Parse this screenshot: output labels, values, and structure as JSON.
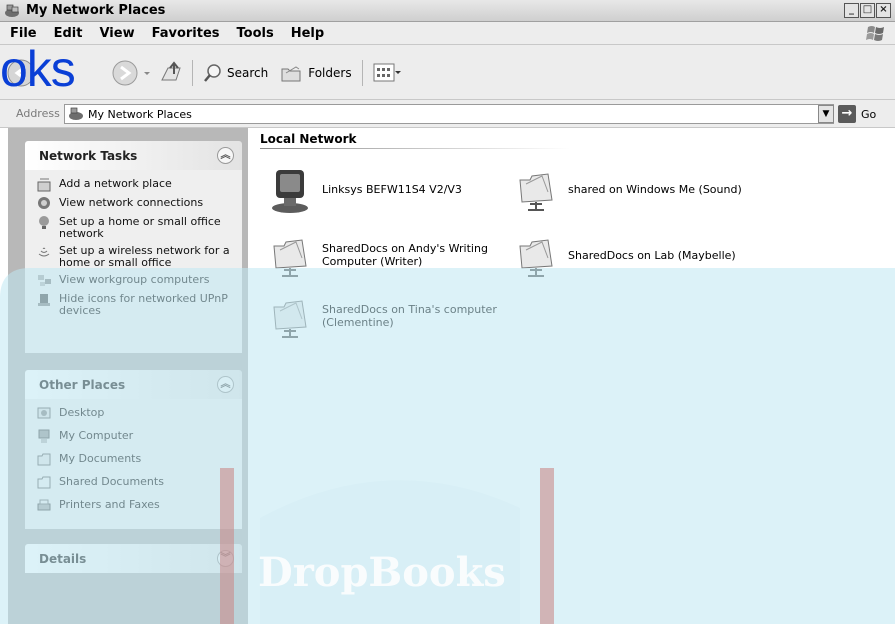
{
  "window": {
    "title": "My Network Places",
    "controls": [
      "minimize",
      "maximize",
      "close"
    ]
  },
  "menu": {
    "items": [
      {
        "label": "File",
        "accel": "F"
      },
      {
        "label": "Edit",
        "accel": "E"
      },
      {
        "label": "View",
        "accel": "V"
      },
      {
        "label": "Favorites",
        "accel": "a"
      },
      {
        "label": "Tools",
        "accel": "T"
      },
      {
        "label": "Help",
        "accel": "H"
      }
    ]
  },
  "toolbar": {
    "overlay_text": "oks",
    "search_label": "Search",
    "folders_label": "Folders",
    "views_icon": "views-icon"
  },
  "address": {
    "label": "Address",
    "value": "My Network Places",
    "go_label": "Go"
  },
  "sidebar": {
    "network_tasks": {
      "title": "Network Tasks",
      "items": [
        {
          "label": "Add a network place",
          "icon": "add-network-place-icon"
        },
        {
          "label": "View network connections",
          "icon": "network-connections-icon"
        },
        {
          "label": "Set up a home or small office network",
          "icon": "home-network-icon"
        },
        {
          "label": "Set up a wireless network for a home or small office",
          "icon": "wireless-network-icon"
        },
        {
          "label": "View workgroup computers",
          "icon": "workgroup-icon"
        },
        {
          "label": "Hide icons for networked UPnP devices",
          "icon": "upnp-icon"
        }
      ]
    },
    "other_places": {
      "title": "Other Places",
      "items": [
        {
          "label": "Desktop",
          "icon": "desktop-icon"
        },
        {
          "label": "My Computer",
          "icon": "my-computer-icon"
        },
        {
          "label": "My Documents",
          "icon": "my-documents-icon"
        },
        {
          "label": "Shared Documents",
          "icon": "shared-documents-icon"
        },
        {
          "label": "Printers and Faxes",
          "icon": "printers-icon"
        }
      ]
    },
    "details": {
      "title": "Details"
    }
  },
  "content": {
    "section_title": "Local Network",
    "items": [
      {
        "label": "Linksys BEFW11S4 V2/V3",
        "icon": "router-icon"
      },
      {
        "label": "shared on Windows Me (Sound)",
        "icon": "network-share-icon"
      },
      {
        "label": "SharedDocs on Andy's Writing Computer (Writer)",
        "icon": "network-share-icon"
      },
      {
        "label": "SharedDocs on Lab (Maybelle)",
        "icon": "network-share-icon"
      },
      {
        "label": "SharedDocs on Tina's computer (Clementine)",
        "icon": "network-share-icon"
      }
    ]
  },
  "watermark": {
    "text": "DropBooks"
  }
}
